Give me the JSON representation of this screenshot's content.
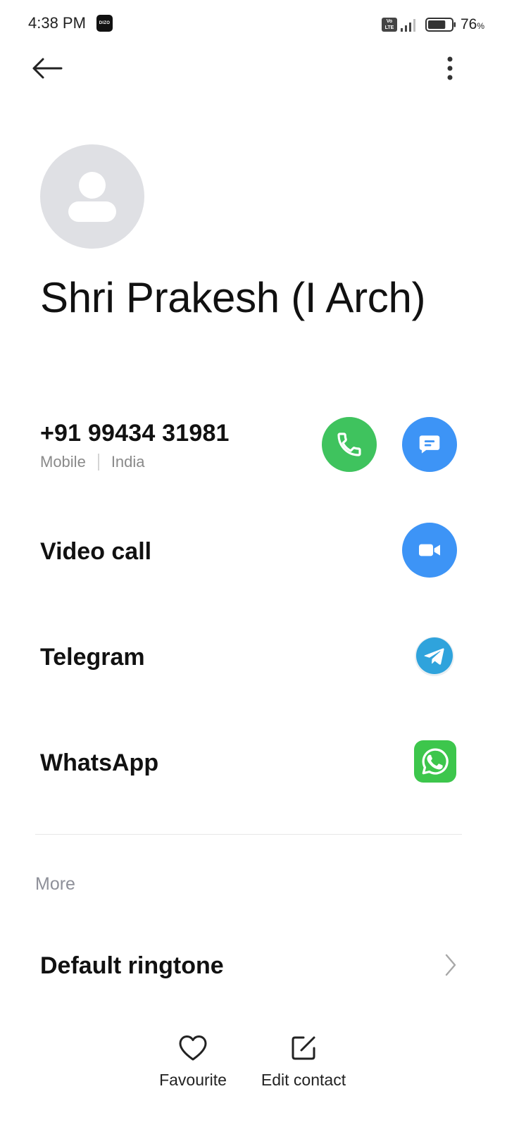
{
  "status_bar": {
    "time": "4:38 PM",
    "app_badge": "DIZO",
    "network_badge_top": "Vo",
    "network_badge_bottom": "LTE",
    "battery_percent": "76",
    "battery_unit": "%",
    "battery_level": 0.76
  },
  "contact": {
    "name": "Shri Prakesh (I Arch)",
    "phone": {
      "number": "+91 99434 31981",
      "type": "Mobile",
      "region": "India"
    }
  },
  "actions": [
    {
      "label": "Video call",
      "icon": "video-camera-icon"
    },
    {
      "label": "Telegram",
      "icon": "telegram-icon"
    },
    {
      "label": "WhatsApp",
      "icon": "whatsapp-icon"
    }
  ],
  "more": {
    "header": "More",
    "items": [
      {
        "label": "Default ringtone",
        "icon": "chevron-right-icon"
      }
    ]
  },
  "bottom_bar": {
    "favourite_label": "Favourite",
    "edit_label": "Edit contact"
  },
  "colors": {
    "call_green": "#3fc35e",
    "action_blue": "#3d94f6",
    "telegram_blue": "#2fa3dc",
    "whatsapp_green": "#3dc64c",
    "avatar_gray": "#dfe0e4"
  }
}
